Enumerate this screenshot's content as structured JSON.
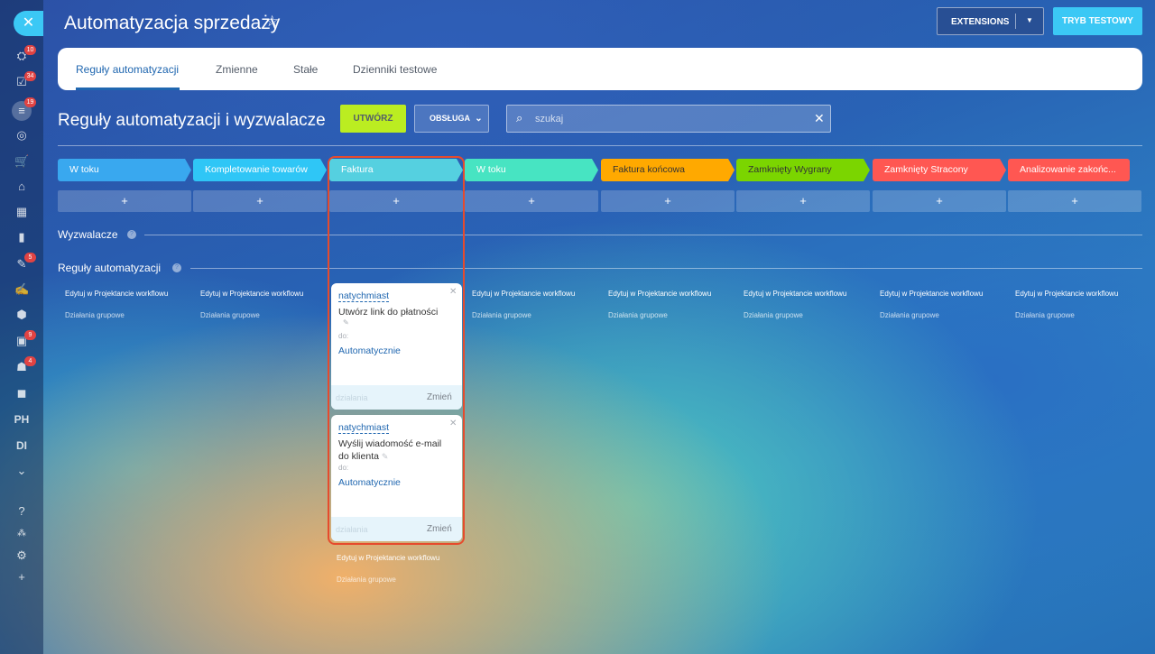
{
  "header": {
    "title": "Automatyzacja sprzedaży",
    "extensions_label": "EXTENSIONS",
    "test_mode_label": "TRYB TESTOWY"
  },
  "sidebar": {
    "badges": [
      "10",
      "34",
      "19",
      "5",
      "9",
      "4"
    ],
    "text_items": [
      "PH",
      "DI"
    ]
  },
  "tabs": [
    {
      "label": "Reguły automatyzacji",
      "active": true
    },
    {
      "label": "Zmienne"
    },
    {
      "label": "Stałe"
    },
    {
      "label": "Dzienniki testowe"
    }
  ],
  "toolbar": {
    "section_title": "Reguły automatyzacji i wyzwalacze",
    "create_label": "UTWÓRZ",
    "service_label": "OBSŁUGA",
    "search_placeholder": "szukaj"
  },
  "stages": [
    {
      "label": "W toku",
      "color": "#39a8ef"
    },
    {
      "label": "Kompletowanie towarów",
      "color": "#2fc6f6"
    },
    {
      "label": "Faktura",
      "color": "#55d0e0"
    },
    {
      "label": "W toku",
      "color": "#47e4c2"
    },
    {
      "label": "Faktura końcowa",
      "color": "#ffa900"
    },
    {
      "label": "Zamknięty Wygrany",
      "color": "#7bd500"
    },
    {
      "label": "Zamknięty Stracony",
      "color": "#ff5752"
    },
    {
      "label": "Analizowanie zakońc...",
      "color": "#ff5752"
    }
  ],
  "sections": {
    "triggers": "Wyzwalacze",
    "rules": "Reguły automatyzacji"
  },
  "column_links": {
    "edit": "Edytuj w Projektancie workflowu",
    "group": "Działania grupowe"
  },
  "robots": [
    {
      "delay": "natychmiast",
      "name": "Utwórz link do płatności",
      "to": "do:",
      "mode": "Automatycznie",
      "actions": "działania",
      "change": "Zmień"
    },
    {
      "delay": "natychmiast",
      "name_line1": "Wyślij wiadomość e-mail",
      "name_line2": "do klienta",
      "to": "do:",
      "mode": "Automatycznie",
      "actions": "działania",
      "change": "Zmień"
    }
  ]
}
